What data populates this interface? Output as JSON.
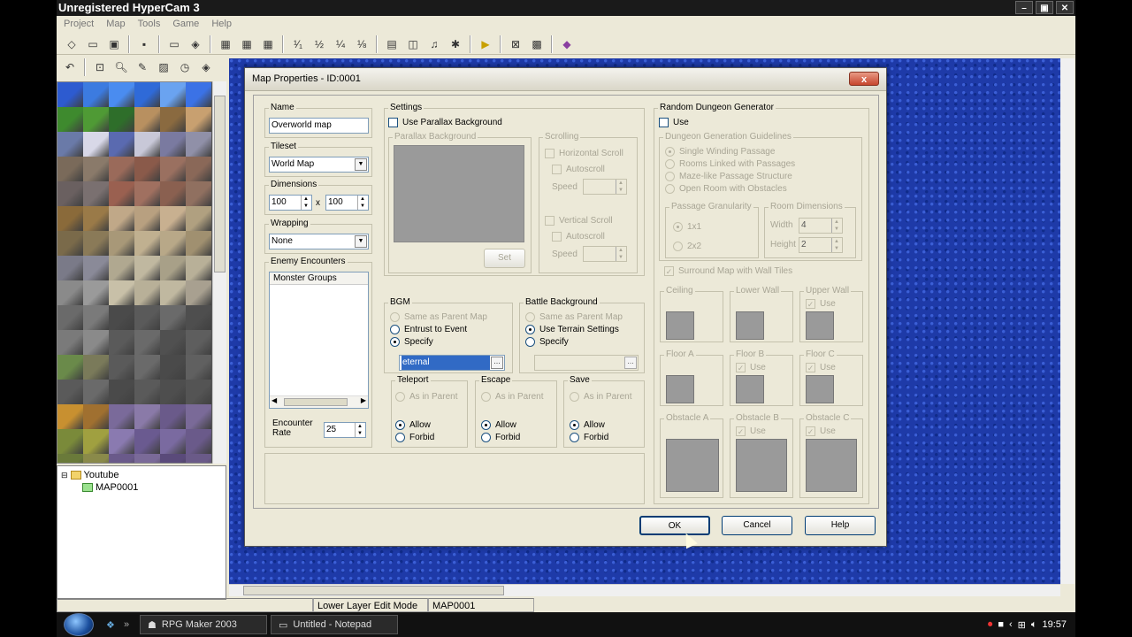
{
  "window": {
    "title": "Unregistered HyperCam 3",
    "controls": [
      "–",
      "▣",
      "✕"
    ]
  },
  "menu": [
    "Project",
    "Map",
    "Tools",
    "Game",
    "Help"
  ],
  "map_tree": {
    "root": "Youtube",
    "child": "MAP0001"
  },
  "statusbar": {
    "layer": "Lower Layer Edit Mode",
    "map": "MAP0001"
  },
  "taskbar": {
    "tasks": [
      "RPG Maker 2003",
      "Untitled - Notepad"
    ],
    "time": "19:57"
  },
  "dialog": {
    "title": "Map Properties - ID:0001",
    "close": "x",
    "name": {
      "label": "Name",
      "value": "Overworld map"
    },
    "tileset": {
      "label": "Tileset",
      "value": "World Map"
    },
    "dimensions": {
      "label": "Dimensions",
      "width": "100",
      "height": "100",
      "x": "x"
    },
    "wrapping": {
      "label": "Wrapping",
      "value": "None"
    },
    "enemy": {
      "label": "Enemy Encounters",
      "col": "Monster Groups",
      "rate_label": "Encounter Rate",
      "rate": "25"
    },
    "settings": {
      "label": "Settings",
      "parallax": "Use Parallax Background",
      "parallax_bg": "Parallax Background",
      "set": "Set",
      "scrolling": "Scrolling",
      "hscroll": "Horizontal Scroll",
      "autoscroll": "Autoscroll",
      "speed": "Speed",
      "vscroll": "Vertical Scroll"
    },
    "bgm": {
      "label": "BGM",
      "opt1": "Same as Parent Map",
      "opt2": "Entrust to Event",
      "opt3": "Specify",
      "value": "eternal"
    },
    "battle": {
      "label": "Battle Background",
      "opt1": "Same as Parent Map",
      "opt2": "Use Terrain Settings",
      "opt3": "Specify"
    },
    "teleport": {
      "label": "Teleport",
      "opt1": "As in Parent",
      "opt2": "Allow",
      "opt3": "Forbid"
    },
    "escape": {
      "label": "Escape",
      "opt1": "As in Parent",
      "opt2": "Allow",
      "opt3": "Forbid"
    },
    "save": {
      "label": "Save",
      "opt1": "As in Parent",
      "opt2": "Allow",
      "opt3": "Forbid"
    },
    "rdg": {
      "label": "Random Dungeon Generator",
      "use": "Use",
      "guidelines": "Dungeon Generation Guidelines",
      "g1": "Single Winding Passage",
      "g2": "Rooms Linked with Passages",
      "g3": "Maze-like Passage Structure",
      "g4": "Open Room with Obstacles",
      "granularity": "Passage Granularity",
      "gr1": "1x1",
      "gr2": "2x2",
      "room_dims": "Room Dimensions",
      "width_label": "Width",
      "width": "4",
      "height_label": "Height",
      "height": "2",
      "surround": "Surround Map with Wall Tiles",
      "ceiling": "Ceiling",
      "lower_wall": "Lower Wall",
      "upper_wall": "Upper Wall",
      "floor_a": "Floor A",
      "floor_b": "Floor B",
      "floor_c": "Floor C",
      "obstacle_a": "Obstacle A",
      "obstacle_b": "Obstacle B",
      "obstacle_c": "Obstacle C"
    },
    "buttons": {
      "ok": "OK",
      "cancel": "Cancel",
      "help": "Help"
    }
  }
}
